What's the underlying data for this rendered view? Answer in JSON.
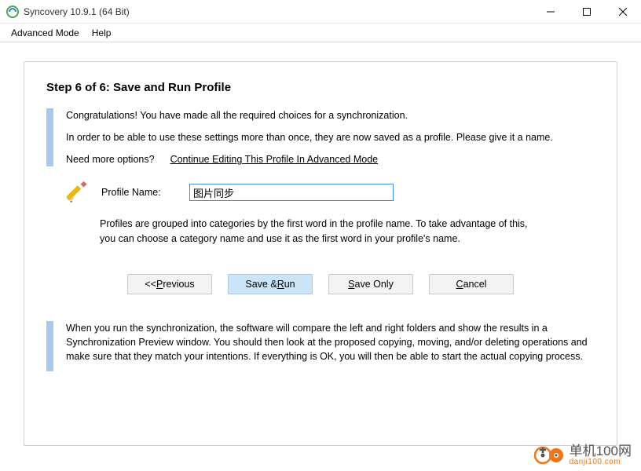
{
  "window": {
    "title": "Syncovery 10.9.1 (64 Bit)"
  },
  "menu": {
    "advanced_mode": "Advanced Mode",
    "help": "Help"
  },
  "step": {
    "title": "Step 6 of 6: Save and Run Profile"
  },
  "intro": {
    "line1": "Congratulations! You have made all the required choices for a synchronization.",
    "line2": "In order to be able to use these settings more than once, they are now saved as a profile. Please give it a name.",
    "need_more": "Need more options?",
    "continue_link": "Continue Editing This Profile In Advanced Mode"
  },
  "profile": {
    "label": "Profile Name:",
    "value": "图片同步"
  },
  "hint": {
    "text": "Profiles are grouped into categories by the first word in the profile name. To take advantage of this, you can choose a category name and use it as the first word in your profile's name."
  },
  "buttons": {
    "previous_prefix": "<< ",
    "previous_u": "P",
    "previous_rest": "revious",
    "saverun_pre": "Save & ",
    "saverun_u": "R",
    "saverun_rest": "un",
    "saveonly_u": "S",
    "saveonly_rest": "ave Only",
    "cancel_u": "C",
    "cancel_rest": "ancel"
  },
  "footer": {
    "text": "When you run the synchronization, the software will compare the left and right folders and show the results in a Synchronization Preview window. You should then look at the proposed copying, moving, and/or deleting operations and make sure that they match your intentions. If everything is OK, you will then be able to start the actual copying process."
  },
  "watermark": {
    "main": "单机100网",
    "sub": "danji100.com"
  }
}
